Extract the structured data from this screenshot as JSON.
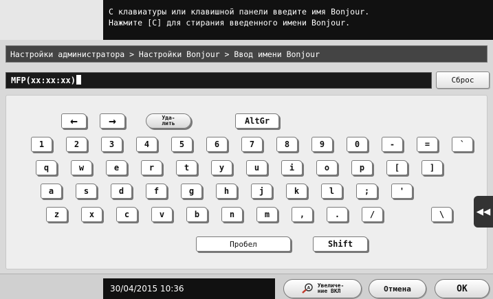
{
  "message": {
    "line1": "С клавиатуры или клавишной панели введите имя Bonjour.",
    "line2": "Нажмите [C] для стирания введенного имени Bonjour."
  },
  "breadcrumb": "Настройки администратора > Настройки Bonjour > Ввод имени Bonjour",
  "input": {
    "value": "MFP(xx:xx:xx)"
  },
  "reset_label": "Сброс",
  "keys": {
    "left_arrow": "←",
    "right_arrow": "→",
    "delete_line1": "Уда-",
    "delete_line2": "лить",
    "altgr": "AltGr",
    "row1": [
      "1",
      "2",
      "3",
      "4",
      "5",
      "6",
      "7",
      "8",
      "9",
      "0",
      "-",
      "=",
      "`"
    ],
    "row2": [
      "q",
      "w",
      "e",
      "r",
      "t",
      "y",
      "u",
      "i",
      "o",
      "p",
      "[",
      "]"
    ],
    "row3": [
      "a",
      "s",
      "d",
      "f",
      "g",
      "h",
      "j",
      "k",
      "l",
      ";",
      "'"
    ],
    "row4": [
      "z",
      "x",
      "c",
      "v",
      "b",
      "n",
      "m",
      ",",
      ".",
      "/",
      "\\"
    ],
    "space": "Пробел",
    "shift": "Shift"
  },
  "side_tab_icon": "◀◀",
  "footer": {
    "datetime": "30/04/2015  10:36",
    "zoom_line1": "Увеличе-",
    "zoom_line2": "ние ВКЛ",
    "cancel": "Отмена",
    "ok": "OK"
  }
}
